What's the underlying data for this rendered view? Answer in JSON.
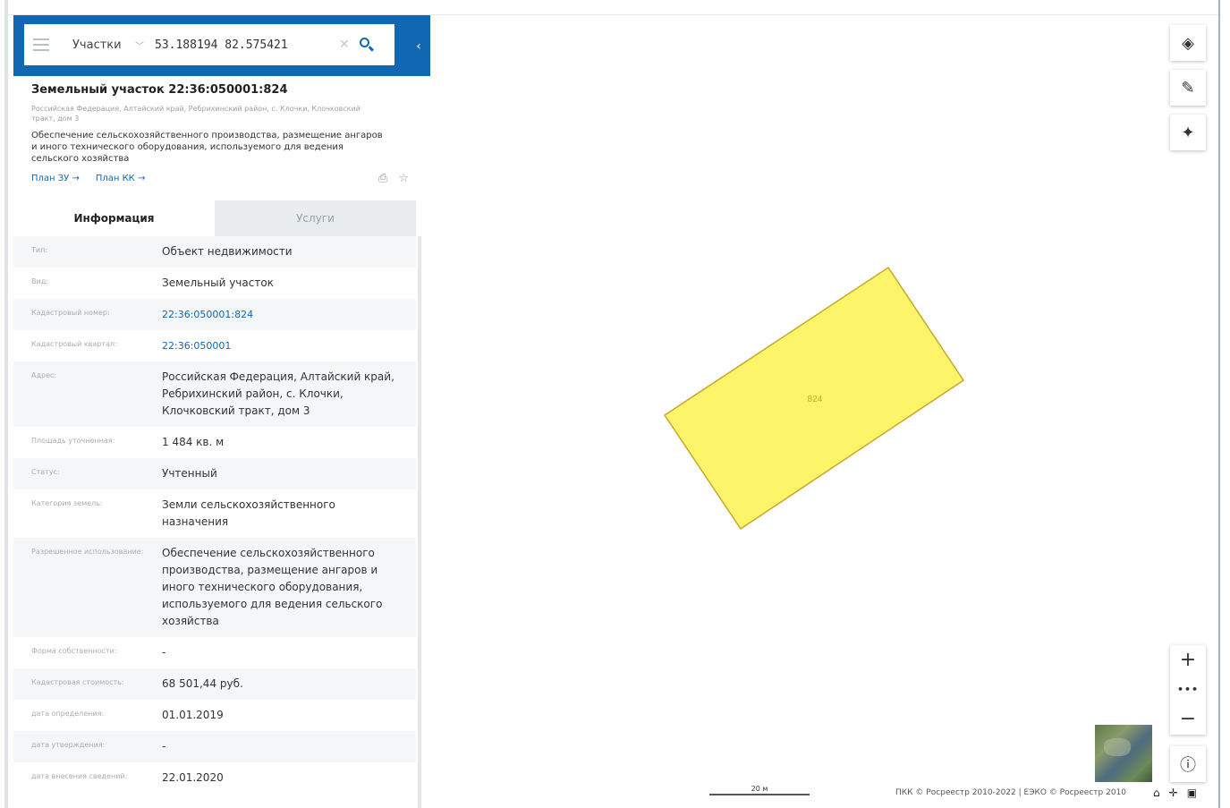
{
  "search": {
    "layer": "Участки",
    "query": "53.188194 82.575421"
  },
  "object": {
    "title": "Земельный участок 22:36:050001:824",
    "address": "Российская Федерация, Алтайский край, Ребрихинский район, с. Клочки, Клочковский тракт, дом 3",
    "description": "Обеспечение сельскохозяйственного производства, размещение ангаров и иного технического оборудования, используемого для ведения сельского хозяйства",
    "link_plan_zu": "План ЗУ →",
    "link_plan_kk": "План КК →"
  },
  "tabs": {
    "info": "Информация",
    "services": "Услуги"
  },
  "info_rows": [
    {
      "label": "Тип:",
      "value": "Объект недвижимости"
    },
    {
      "label": "Вид:",
      "value": "Земельный участок"
    },
    {
      "label": "Кадастровый номер:",
      "value": "22:36:050001:824"
    },
    {
      "label": "Кадастровый квартал:",
      "value": "22:36:050001"
    },
    {
      "label": "Адрес:",
      "value": "Российская Федерация, Алтайский край, Ребрихинский район, с. Клочки, Клочковский тракт, дом 3"
    },
    {
      "label": "Площадь уточненная:",
      "value": "1 484 кв. м"
    },
    {
      "label": "Статус:",
      "value": "Учтенный"
    },
    {
      "label": "Категория земель:",
      "value": "Земли сельскохозяйственного назначения"
    },
    {
      "label": "Разрешенное использование:",
      "value": "Обеспечение сельскохозяйственного производства, размещение ангаров и иного технического оборудования, используемого для ведения сельского хозяйства"
    },
    {
      "label": "Форма собственности:",
      "value": "-"
    },
    {
      "label": "Кадастровая стоимость:",
      "value": "68 501,44 руб."
    },
    {
      "label": "дата определения:",
      "value": "01.01.2019"
    },
    {
      "label": "дата утверждения:",
      "value": "-"
    },
    {
      "label": "дата внесения сведений:",
      "value": "22.01.2020"
    }
  ],
  "map": {
    "parcel_label": "824",
    "parcel_fill": "#fcf56a",
    "parcel_stroke": "#c9a72a",
    "scale": "20 м",
    "attribution": "ПКК © Росреестр 2010-2022 | ЕЭКО © Росреестр 2010"
  },
  "colors": {
    "accent": "#1167b1"
  }
}
